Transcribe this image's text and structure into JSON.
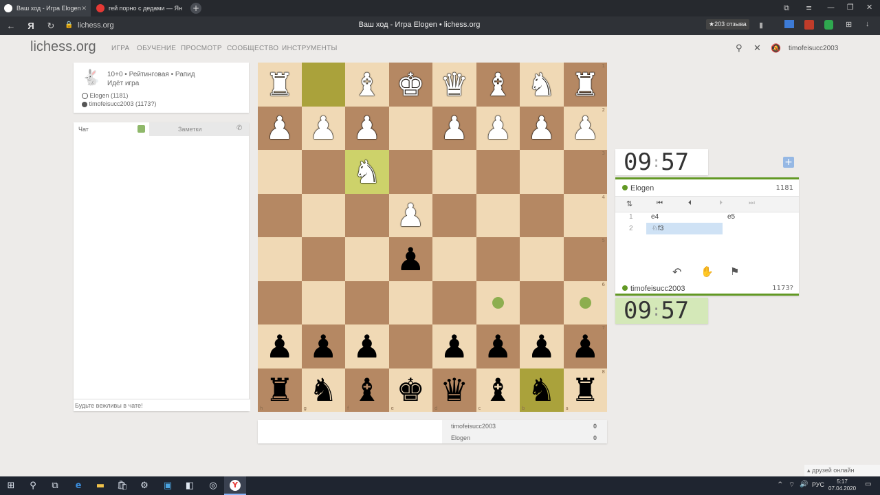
{
  "browser": {
    "tabs": [
      {
        "label": "Ваш ход - Игра Elogen",
        "active": true
      },
      {
        "label": "гей порно с дедами — Ян",
        "active": false
      }
    ],
    "address": "lichess.org",
    "page_title": "Ваш ход - Игра Elogen • lichess.org",
    "reviews": "★203 отзыва"
  },
  "header": {
    "logo": "lichess.org",
    "nav": [
      "ИГРА",
      "ОБУЧЕНИЕ",
      "ПРОСМОТР",
      "СООБЩЕСТВО",
      "ИНСТРУМЕНТЫ"
    ],
    "username": "timofeisucc2003"
  },
  "game_info": {
    "type": "10+0 • Рейтинговая • Рапид",
    "status": "Идёт игра",
    "white_player": "Elogen (1181)",
    "black_player": "timofeisucc2003 (1173?)"
  },
  "chat": {
    "tab_chat": "Чат",
    "tab_notes": "Заметки",
    "placeholder": "Будьте вежливы в чате!"
  },
  "board": {
    "rows": [
      [
        {
          "p": "♜",
          "c": "w"
        },
        {
          "p": "",
          "c": ""
        },
        {
          "p": "♝",
          "c": "w"
        },
        {
          "p": "♚",
          "c": "w"
        },
        {
          "p": "♛",
          "c": "w"
        },
        {
          "p": "♝",
          "c": "w"
        },
        {
          "p": "♞",
          "c": "w"
        },
        {
          "p": "♜",
          "c": "w"
        }
      ],
      [
        {
          "p": "♟",
          "c": "w"
        },
        {
          "p": "♟",
          "c": "w"
        },
        {
          "p": "♟",
          "c": "w"
        },
        {
          "p": "",
          "c": ""
        },
        {
          "p": "♟",
          "c": "w"
        },
        {
          "p": "♟",
          "c": "w"
        },
        {
          "p": "♟",
          "c": "w"
        },
        {
          "p": "♟",
          "c": "w"
        }
      ],
      [
        {
          "p": "",
          "c": ""
        },
        {
          "p": "",
          "c": ""
        },
        {
          "p": "♞",
          "c": "w"
        },
        {
          "p": "",
          "c": ""
        },
        {
          "p": "",
          "c": ""
        },
        {
          "p": "",
          "c": ""
        },
        {
          "p": "",
          "c": ""
        },
        {
          "p": "",
          "c": ""
        }
      ],
      [
        {
          "p": "",
          "c": ""
        },
        {
          "p": "",
          "c": ""
        },
        {
          "p": "",
          "c": ""
        },
        {
          "p": "♟",
          "c": "w"
        },
        {
          "p": "",
          "c": ""
        },
        {
          "p": "",
          "c": ""
        },
        {
          "p": "",
          "c": ""
        },
        {
          "p": "",
          "c": ""
        }
      ],
      [
        {
          "p": "",
          "c": ""
        },
        {
          "p": "",
          "c": ""
        },
        {
          "p": "",
          "c": ""
        },
        {
          "p": "♟",
          "c": "b"
        },
        {
          "p": "",
          "c": ""
        },
        {
          "p": "",
          "c": ""
        },
        {
          "p": "",
          "c": ""
        },
        {
          "p": "",
          "c": ""
        }
      ],
      [
        {
          "p": "",
          "c": ""
        },
        {
          "p": "",
          "c": ""
        },
        {
          "p": "",
          "c": ""
        },
        {
          "p": "",
          "c": ""
        },
        {
          "p": "",
          "c": ""
        },
        {
          "p": "",
          "c": ""
        },
        {
          "p": "",
          "c": ""
        },
        {
          "p": "",
          "c": ""
        }
      ],
      [
        {
          "p": "♟",
          "c": "b"
        },
        {
          "p": "♟",
          "c": "b"
        },
        {
          "p": "♟",
          "c": "b"
        },
        {
          "p": "",
          "c": ""
        },
        {
          "p": "♟",
          "c": "b"
        },
        {
          "p": "♟",
          "c": "b"
        },
        {
          "p": "♟",
          "c": "b"
        },
        {
          "p": "♟",
          "c": "b"
        }
      ],
      [
        {
          "p": "♜",
          "c": "b"
        },
        {
          "p": "♞",
          "c": "b"
        },
        {
          "p": "♝",
          "c": "b"
        },
        {
          "p": "♚",
          "c": "b"
        },
        {
          "p": "♛",
          "c": "b"
        },
        {
          "p": "♝",
          "c": "b"
        },
        {
          "p": "♞",
          "c": "b"
        },
        {
          "p": "♜",
          "c": "b"
        }
      ]
    ],
    "rank_labels": [
      "1",
      "2",
      "3",
      "4",
      "5",
      "6",
      "7",
      "8"
    ],
    "file_labels": [
      "h",
      "g",
      "f",
      "e",
      "d",
      "c",
      "b",
      "a"
    ],
    "last_move_squares": [
      [
        0,
        1
      ],
      [
        2,
        2
      ]
    ],
    "selected_square": [
      7,
      6
    ],
    "move_dots": [
      [
        5,
        5
      ],
      [
        5,
        7
      ]
    ]
  },
  "clocks": {
    "top": {
      "min": "09",
      "sec": "57"
    },
    "bottom": {
      "min": "09",
      "sec": "57"
    }
  },
  "players": {
    "top": {
      "name": "Elogen",
      "rating": "1181"
    },
    "bottom": {
      "name": "timofeisucc2003",
      "rating": "1173?"
    }
  },
  "moves": [
    {
      "num": "1",
      "white": "e4",
      "black": "e5"
    },
    {
      "num": "2",
      "white": "♘f3",
      "black": ""
    }
  ],
  "score": [
    {
      "name": "timofeisucc2003",
      "value": "0"
    },
    {
      "name": "Elogen",
      "value": "0"
    }
  ],
  "taskbar": {
    "friends": "друзей онлайн",
    "lang": "РУС",
    "time": "5:17",
    "date": "07.04.2020"
  }
}
